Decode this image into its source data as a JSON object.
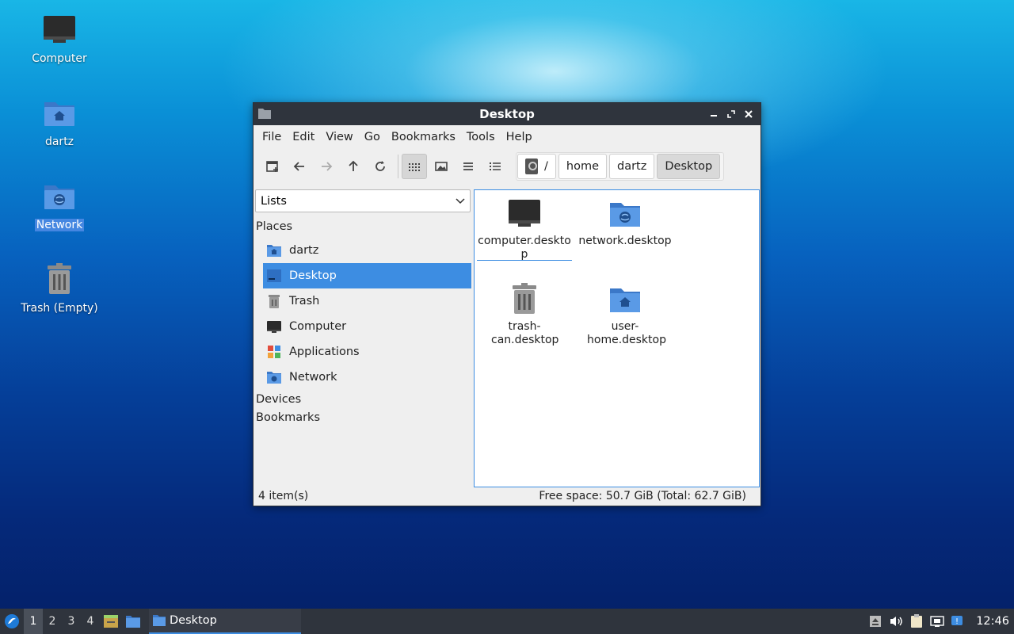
{
  "desktop": {
    "icons": [
      {
        "label": "Computer",
        "icon": "computer-icon"
      },
      {
        "label": "dartz",
        "icon": "home-folder-icon"
      },
      {
        "label": "Network",
        "icon": "network-folder-icon"
      },
      {
        "label": "Trash (Empty)",
        "icon": "trash-icon"
      }
    ]
  },
  "window": {
    "title": "Desktop",
    "menu": [
      "File",
      "Edit",
      "View",
      "Go",
      "Bookmarks",
      "Tools",
      "Help"
    ],
    "path": [
      "/",
      "home",
      "dartz",
      "Desktop"
    ],
    "sidebar": {
      "mode": "Lists",
      "sections": {
        "places": "Places",
        "devices": "Devices",
        "bookmarks": "Bookmarks"
      },
      "places": [
        {
          "label": "dartz",
          "icon": "home-folder-icon"
        },
        {
          "label": "Desktop",
          "icon": "desktop-icon"
        },
        {
          "label": "Trash",
          "icon": "trash-icon"
        },
        {
          "label": "Computer",
          "icon": "computer-icon"
        },
        {
          "label": "Applications",
          "icon": "applications-icon"
        },
        {
          "label": "Network",
          "icon": "network-folder-icon"
        }
      ]
    },
    "files": [
      {
        "name": "computer.desktop",
        "icon": "computer-icon"
      },
      {
        "name": "network.desktop",
        "icon": "network-folder-icon"
      },
      {
        "name": "trash-can.desktop",
        "icon": "trash-icon"
      },
      {
        "name": "user-home.desktop",
        "icon": "home-folder-icon"
      }
    ],
    "status": {
      "count": "4 item(s)",
      "space": "Free space: 50.7 GiB (Total: 62.7 GiB)"
    }
  },
  "taskbar": {
    "workspaces": [
      "1",
      "2",
      "3",
      "4"
    ],
    "task": "Desktop",
    "clock": "12:46"
  },
  "colors": {
    "accent": "#3d8de2",
    "titlebar": "#2f343d",
    "folder": "#4a8fe0"
  }
}
